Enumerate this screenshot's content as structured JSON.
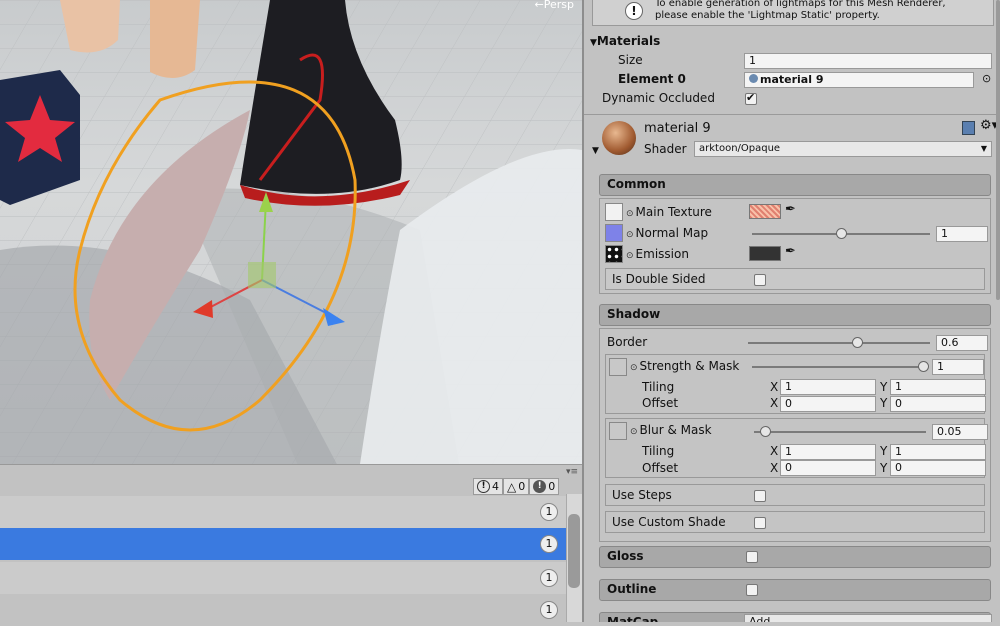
{
  "scene": {
    "persp_label": "←Persp"
  },
  "console": {
    "warn_count": "4",
    "tri_count": "0",
    "err_count": "0",
    "rows": [
      {
        "count": "1"
      },
      {
        "count": "1"
      },
      {
        "count": "1"
      },
      {
        "count": "1"
      }
    ]
  },
  "inspector": {
    "notice": "To enable generation of lightmaps for this Mesh Renderer, please enable the 'Lightmap Static' property.",
    "materials_label": "Materials",
    "size_label": "Size",
    "size_value": "1",
    "element0_label": "Element 0",
    "element0_value": "material 9",
    "dynamic_occluded_label": "Dynamic Occluded",
    "material_name": "material 9",
    "shader_label": "Shader",
    "shader_value": "arktoon/Opaque",
    "common": {
      "header": "Common",
      "main_texture": "Main Texture",
      "normal_map": "Normal Map",
      "normal_map_value": "1",
      "emission": "Emission",
      "double_sided": "Is Double Sided"
    },
    "shadow": {
      "header": "Shadow",
      "border": "Border",
      "border_value": "0.6",
      "strength_mask": "Strength & Mask",
      "strength_value": "1",
      "tiling": "Tiling",
      "offset": "Offset",
      "x": "X",
      "y": "Y",
      "tiling1_x": "1",
      "tiling1_y": "1",
      "offset1_x": "0",
      "offset1_y": "0",
      "blur_mask": "Blur & Mask",
      "blur_value": "0.05",
      "tiling2_x": "1",
      "tiling2_y": "1",
      "offset2_x": "0",
      "offset2_y": "0",
      "use_steps": "Use Steps",
      "use_custom_shade": "Use Custom Shade"
    },
    "gloss_header": "Gloss",
    "outline_header": "Outline",
    "matcap_header": "MatCap",
    "matcap_value": "Add"
  },
  "colors": {
    "selection": "#3a7ae0",
    "outline": "#f0a020"
  }
}
